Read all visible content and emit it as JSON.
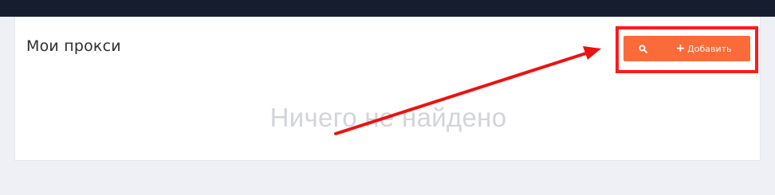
{
  "page": {
    "title": "Мои прокси",
    "empty_message": "Ничего не найдено"
  },
  "toolbar": {
    "search_icon": "search-icon",
    "add_icon": "plus-icon",
    "add_label": "Добавить"
  },
  "colors": {
    "topbar": "#161d2f",
    "accent": "#fb6a39",
    "annotation": "#ff1a1a",
    "background": "#eef0f5"
  }
}
